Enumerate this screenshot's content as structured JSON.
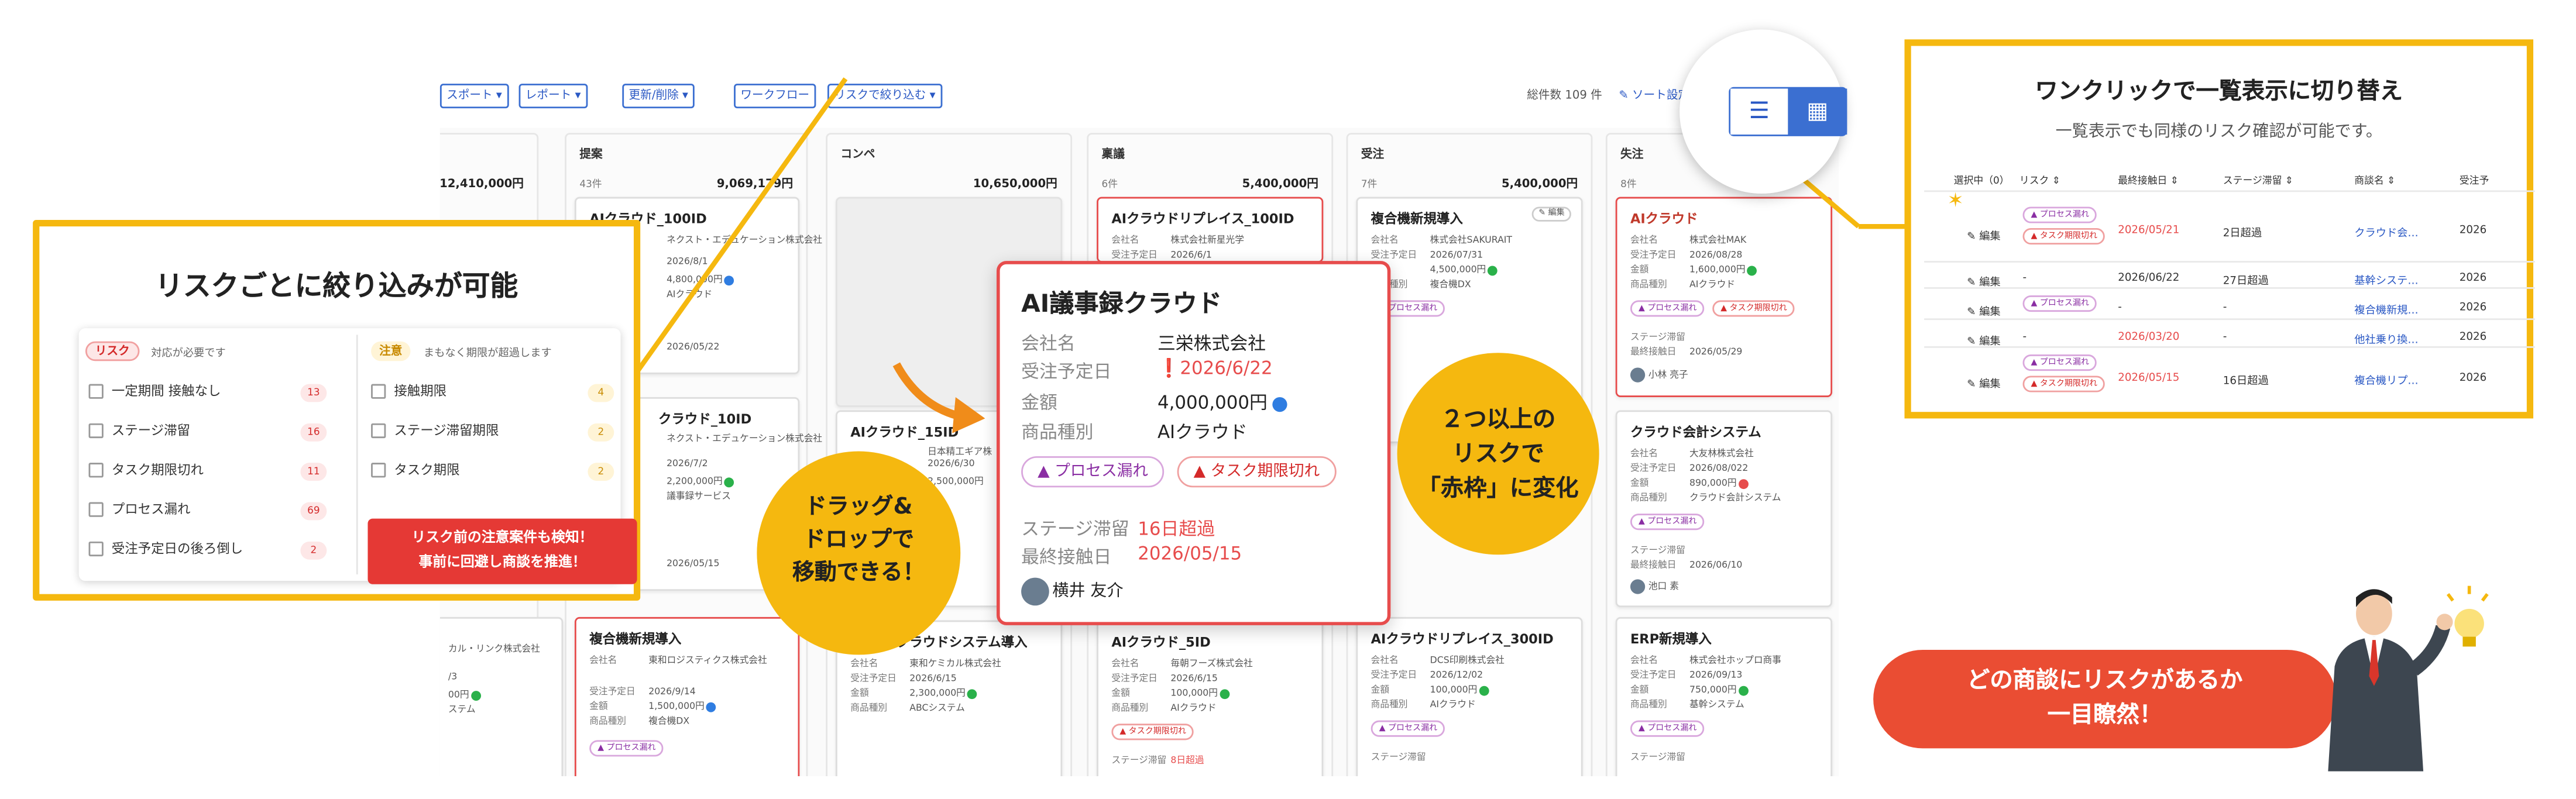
{
  "toolbar": {
    "export": "スポート ▾",
    "report": "レポート ▾",
    "update": "更新/削除 ▾",
    "workflow": "ワークフロー",
    "risk_filter": "リスクで絞り込む ▾",
    "total": "総件数 109 件",
    "sort": "ソート設定"
  },
  "columns": [
    {
      "name": "",
      "count": "",
      "total": "12,410,000円"
    },
    {
      "name": "提案",
      "count": "43件",
      "total": "9,069,179円"
    },
    {
      "name": "コンペ",
      "count": "",
      "total": "10,650,000円"
    },
    {
      "name": "稟議",
      "count": "6件",
      "total": "5,400,000円"
    },
    {
      "name": "受注",
      "count": "7件",
      "total": "5,400,000円"
    },
    {
      "name": "失注",
      "count": "8件",
      "total": ""
    }
  ],
  "labels": {
    "company": "会社名",
    "order_date": "受注予定日",
    "amount": "金額",
    "product": "商品種別",
    "stage_stay": "ステージ滞留",
    "last_contact": "最終接触日",
    "edit": "編集"
  },
  "tags": {
    "process": "プロセス漏れ",
    "task": "タスク期限切れ"
  },
  "cards": {
    "c1": {
      "title": "AIクラウド_100ID",
      "company": "ネクスト・エデュケーション株式会社",
      "date": "2026/8/1",
      "amount": "4,800,000円",
      "product": "AIクラウド",
      "last": "2026/05/22"
    },
    "c2": {
      "title": "クラウド_10ID",
      "company": "ネクスト・エデュケーション株式会社",
      "date": "2026/7/2",
      "amount": "2,200,000円",
      "product": "議事録サービス",
      "last": "2026/05/15"
    },
    "c3": {
      "title": "複合機新規導入",
      "company": "東和ロジスティクス株式会社",
      "date": "2026/9/14",
      "amount": "1,500,000円",
      "product": "複合機DX"
    },
    "c4": {
      "title": "AIクラウドリプレイス_100ID",
      "company": "株式会社新星光学",
      "date": "2026/6/1"
    },
    "c5": {
      "title": "AIクラウド_15ID",
      "company": "日本精工ギア株",
      "date": "2026/6/30",
      "amount": "2,500,000円"
    },
    "c6": {
      "title": "クラウドシステム導入",
      "company": "東和ケミカル株式会社",
      "date": "2026/6/15",
      "amount": "2,300,000円",
      "product": "ABCシステム"
    },
    "c7": {
      "title": "AIクラウド_5ID",
      "company": "毎朝フーズ株式会社",
      "date": "2026/6/15",
      "amount": "100,000円",
      "product": "AIクラウド",
      "stage": "8日超過"
    },
    "c8": {
      "title": "複合機新規導入",
      "company": "株式会社SAKURAIT",
      "date": "2026/07/31",
      "amount": "4,500,000円",
      "product": "複合機DX"
    },
    "c9": {
      "title": "AIクラウドリプレイス_300ID",
      "company": "DCS印刷株式会社",
      "date": "2026/12/02",
      "amount": "100,000円",
      "product": "AIクラウド"
    },
    "c10": {
      "title": "AIクラウド",
      "company": "株式会社MAK",
      "date": "2026/08/28",
      "amount": "1,600,000円",
      "product": "AIクラウド",
      "last": "2026/05/29",
      "owner": "小林 亮子"
    },
    "c11": {
      "title": "クラウド会計システム",
      "company": "大友林株式会社",
      "date": "2026/08/022",
      "amount": "890,000円",
      "product": "クラウド会計システム",
      "last": "2026/06/10",
      "owner": "池口 素"
    },
    "c12": {
      "title": "ERP新規導入",
      "company": "株式会社ホップロ商事",
      "date": "2026/09/13",
      "amount": "750,000円",
      "product": "基幹システム"
    },
    "c13": {
      "title": "",
      "company": "カル・リンク株式会社",
      "date": "/3",
      "amount": "00円",
      "product": "ステム"
    }
  },
  "filter_box": {
    "title": "リスクごとに絞り込みが可能",
    "risk_badge": "リスク",
    "risk_desc": "対応が必要です",
    "warn_badge": "注意",
    "warn_desc": "まもなく期限が超過します",
    "risk_items": [
      {
        "label": "一定期間 接触なし",
        "count": "13"
      },
      {
        "label": "ステージ滞留",
        "count": "16"
      },
      {
        "label": "タスク期限切れ",
        "count": "11"
      },
      {
        "label": "プロセス漏れ",
        "count": "69"
      },
      {
        "label": "受注予定日の後ろ倒し",
        "count": "2"
      }
    ],
    "warn_items": [
      {
        "label": "接触期限",
        "count": "4"
      },
      {
        "label": "ステージ滞留期限",
        "count": "2"
      },
      {
        "label": "タスク期限",
        "count": "2"
      }
    ],
    "callout_line1": "リスク前の注意案件も検知！",
    "callout_line2": "事前に回避し商談を推進！"
  },
  "drag_circle": [
    "ドラッグ&",
    "ドロップで",
    "移動できる！"
  ],
  "red_circle": [
    "２つ以上の",
    "リスクで",
    "「赤枠」に変化"
  ],
  "popup": {
    "title": "AI議事録クラウド",
    "company": "三栄株式会社",
    "date": "2026/6/22",
    "amount": "4,000,000円",
    "product": "AIクラウド",
    "stage": "16日超過",
    "last": "2026/05/15",
    "owner": "横井 友介"
  },
  "list_view": {
    "title": "ワンクリックで一覧表示に切り替え",
    "subtitle": "一覧表示でも同様のリスク確認が可能です。",
    "headers": [
      "選択中（0）",
      "リスク ⇕",
      "最終接触日 ⇕",
      "ステージ滞留 ⇕",
      "商談名 ⇕",
      "受注予"
    ],
    "rows": [
      {
        "edit": "編集",
        "tags": [
          "プロセス漏れ",
          "タスク期限切れ"
        ],
        "last": "2026/05/21",
        "last_red": true,
        "stage": "2日超過",
        "deal": "クラウド会…",
        "order": "2026"
      },
      {
        "edit": "編集",
        "tags": [],
        "last": "2026/06/22",
        "last_red": false,
        "stage": "27日超過",
        "deal": "基幹システ…",
        "order": "2026"
      },
      {
        "edit": "編集",
        "tags": [
          "プロセス漏れ"
        ],
        "last": "-",
        "last_red": false,
        "stage": "-",
        "deal": "複合機新規…",
        "order": "2026"
      },
      {
        "edit": "編集",
        "tags": [],
        "last": "2026/03/20",
        "last_red": true,
        "stage": "-",
        "deal": "他社乗り換…",
        "order": "2026"
      },
      {
        "edit": "編集",
        "tags": [
          "プロセス漏れ",
          "タスク期限切れ"
        ],
        "last": "2026/05/15",
        "last_red": true,
        "stage": "16日超過",
        "deal": "複合機リプ…",
        "order": "2026"
      }
    ]
  },
  "banner": [
    "どの商談にリスクがあるか",
    "一目瞭然！"
  ],
  "colors": {
    "accent": "#f5b80f",
    "risk": "#e74c4c",
    "brand_blue": "#2a58c4",
    "banner": "#ea4d33"
  }
}
